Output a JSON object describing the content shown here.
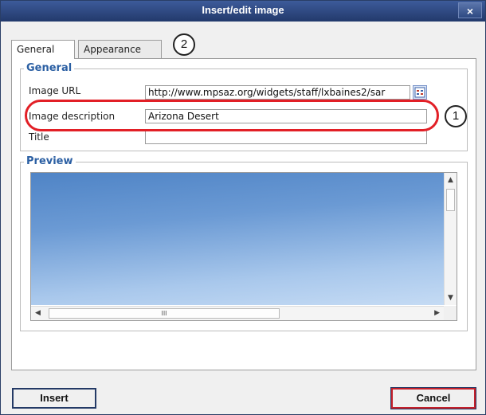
{
  "dialog": {
    "title": "Insert/edit image",
    "close_label": "×"
  },
  "tabs": [
    {
      "label": "General",
      "active": true
    },
    {
      "label": "Appearance",
      "active": false
    }
  ],
  "general": {
    "legend": "General",
    "image_url_label": "Image URL",
    "image_url_value": "http://www.mpsaz.org/widgets/staff/lxbaines2/sar",
    "image_description_label": "Image description",
    "image_description_value": "Arizona Desert",
    "title_label": "Title",
    "title_value": ""
  },
  "preview": {
    "legend": "Preview",
    "scroll_grip": "III"
  },
  "callouts": {
    "one": "1",
    "two": "2"
  },
  "buttons": {
    "insert": "Insert",
    "cancel": "Cancel"
  },
  "colors": {
    "title_bar": "#2a4478",
    "legend_text": "#2b5fa3",
    "annotation_red": "#e21f26"
  },
  "icons": {
    "browse": "browse-list-icon"
  }
}
